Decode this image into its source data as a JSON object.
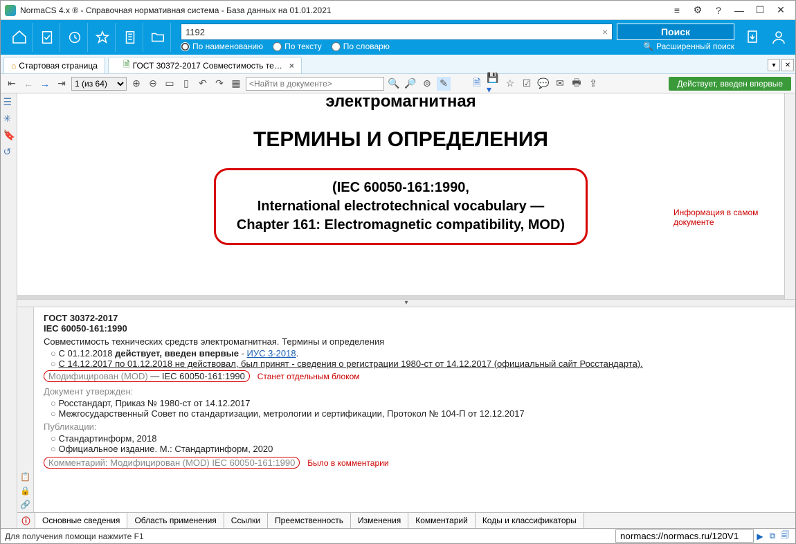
{
  "window": {
    "title": "NormaCS 4.x ® - Справочная нормативная система - База данных на 01.01.2021"
  },
  "toolbar": {
    "search_value": "1192",
    "search_button": "Поиск",
    "radio_name": "По наименованию",
    "radio_text": "По тексту",
    "radio_dict": "По словарю",
    "adv_search": "Расширенный поиск"
  },
  "tabs": {
    "start": "Стартовая страница",
    "doc": "ГОСТ 30372-2017 Совместимость те…"
  },
  "doc_toolbar": {
    "page_of": "1 (из 64)",
    "find_placeholder": "<Найти в документе>",
    "status": "Действует, введен впервые"
  },
  "document": {
    "line1": "электромагнитная",
    "title": "ТЕРМИНЫ И ОПРЕДЕЛЕНИЯ",
    "iec1": "(IEC 60050-161:1990,",
    "iec2": "International electrotechnical vocabulary —",
    "iec3": "Chapter 161: Electromagnetic compatibility, MOD)",
    "annot": "Информация в самом документе"
  },
  "info": {
    "code1": "ГОСТ 30372-2017",
    "code2": "IEC 60050-161:1990",
    "name": "Совместимость технических средств электромагнитная. Термины и определения",
    "status1_a": "С 01.12.2018 ",
    "status1_b": "действует, введен впервые",
    "status1_c": " - ",
    "status1_link": "ИУС 3-2018",
    "status1_d": ".",
    "status2": "С 14.12.2017 по 01.12.2018 не действовал, был принят - сведения о регистрации 1980-ст от 14.12.2017 (официальный сайт Росстандарта).",
    "mod_a": "Модифицирован (MOD)",
    "mod_b": " — IEC 60050-161:1990",
    "mod_note": "Станет отдельным блоком",
    "approved_h": "Документ утвержден:",
    "approved1": "Росстандарт, Приказ № 1980-ст от 14.12.2017",
    "approved2": "Межгосударственный Совет по стандартизации, метрологии и сертификации, Протокол № 104-П от 12.12.2017",
    "pub_h": "Публикации:",
    "pub1": "Стандартинформ, 2018",
    "pub2": "Официальное издание. М.: Стандартинформ, 2020",
    "comment_a": "Комментарий: Модифицирован (MOD) IEC 60050-161:1990",
    "comment_note": "Было в комментарии"
  },
  "bottom_tabs": {
    "t1": "Основные сведения",
    "t2": "Область применения",
    "t3": "Ссылки",
    "t4": "Преемственность",
    "t5": "Изменения",
    "t6": "Комментарий",
    "t7": "Коды и классификаторы"
  },
  "statusbar": {
    "help": "Для получения помощи нажмите F1",
    "url": "normacs://normacs.ru/120V1"
  }
}
